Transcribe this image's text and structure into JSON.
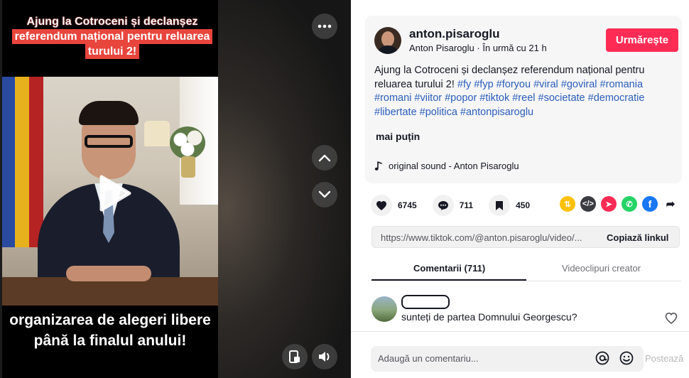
{
  "video": {
    "caption_top_line1": "Ajung la Cotroceni și declanșez",
    "caption_top_line2": "referendum național pentru reluarea",
    "caption_top_line3": "turului 2!",
    "caption_bottom": "organizarea de alegeri libere până la finalul anului!"
  },
  "post": {
    "username": "anton.pisaroglu",
    "display_name": "Anton Pisaroglu",
    "time_ago": "În urmă cu 21 h",
    "follow_label": "Urmărește",
    "description_text": "Ajung la Cotroceni și declanșez referendum național pentru reluarea turului 2!",
    "hashtags": "#fy #fyp #foryou #viral #goviral #romania #romani #viitor #popor #tiktok #reel #societate #democratie #libertate #politica #antonpisaroglu",
    "more_label": "mai puțin",
    "sound": "original sound - Anton Pisaroglu"
  },
  "stats": {
    "likes": "6745",
    "comments": "711",
    "saves": "450"
  },
  "link": {
    "url": "https://www.tiktok.com/@anton.pisaroglu/video/...",
    "copy_label": "Copiază linkul"
  },
  "tabs": {
    "comments": "Comentarii (711)",
    "creator_videos": "Videoclipuri creator"
  },
  "comment": {
    "text": "sunteți de partea Domnului Georgescu?"
  },
  "composer": {
    "placeholder": "Adaugă un comentariu...",
    "post_label": "Postează"
  },
  "colors": {
    "accent": "#fe2c55",
    "hashtag": "#2b5db9"
  }
}
